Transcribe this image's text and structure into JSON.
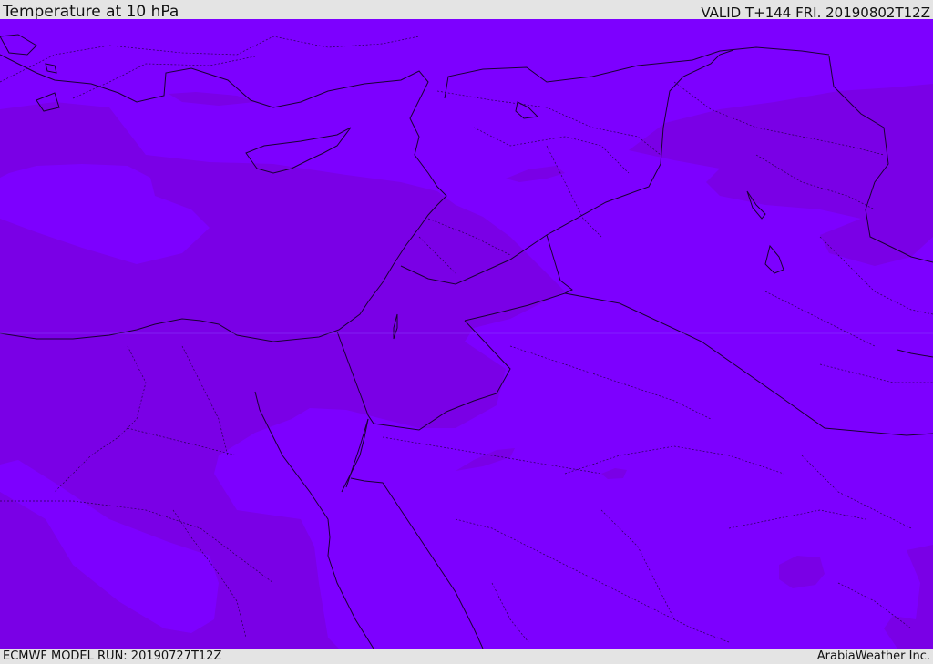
{
  "header": {
    "title": "Temperature at 10 hPa",
    "valid_time": "VALID T+144 FRI. 20190802T12Z"
  },
  "footer": {
    "model_run": "ECMWF MODEL RUN: 20190727T12Z",
    "provider": "ArabiaWeather Inc."
  },
  "map": {
    "colors": {
      "field_light": "#7d00ff",
      "field_dark": "#7a00e6",
      "coastline": "#1a0033",
      "border": "#1a0033"
    }
  }
}
